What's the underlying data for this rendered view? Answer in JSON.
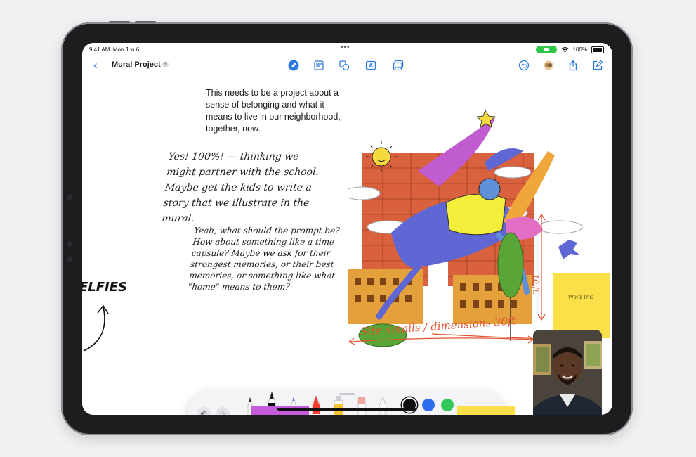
{
  "status_bar": {
    "time": "9:41 AM",
    "date": "Mon Jun 6",
    "battery": "100%"
  },
  "toolbar": {
    "title": "Mural Project"
  },
  "canvas": {
    "typed_note": "This needs to be a project about a sense of belonging and what it means to live in our neighborhood, together, now.",
    "handwritten_note_1": "Yes! 100%! — thinking we might partner with the school. Maybe get the kids to write a story that we illustrate in the mural.",
    "handwritten_note_2": "Yeah, what should the prompt be? How about something like a time capsule? Maybe we ask for their strongest memories, or their best memories, or something like what \"home\" means to them?",
    "selfies_label": "ELFIES",
    "site_note": "Site details / dimensions 30ft",
    "height_note": "10 ft.",
    "sticky_note_text": "Word This"
  },
  "colors": {
    "accent": "#2c7be5",
    "ink_orange": "#e0542e",
    "sticky_yellow": "#fbe04a",
    "sticky_purple": "#c45bd8",
    "facetime_green": "#30c84a"
  },
  "palette": {
    "tools": [
      "pen",
      "marker",
      "pencil",
      "crayon",
      "fill",
      "eraser",
      "lasso"
    ],
    "swatches": [
      "#111111",
      "#2d6cf0",
      "#34c759",
      "#f7c531",
      "#ff3b30",
      "multicolor"
    ]
  }
}
